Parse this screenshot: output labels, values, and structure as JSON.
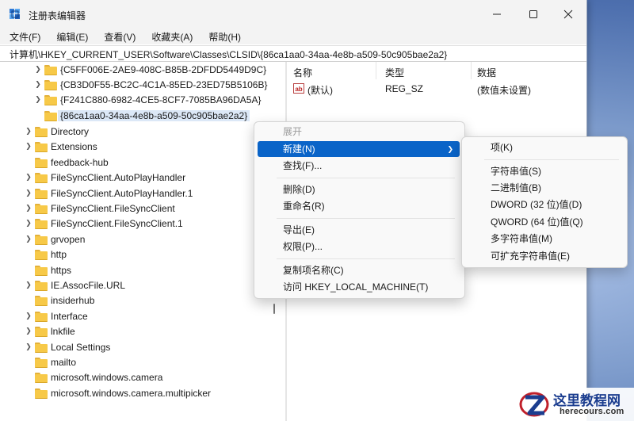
{
  "window": {
    "title": "注册表编辑器"
  },
  "menu": [
    "文件(F)",
    "编辑(E)",
    "查看(V)",
    "收藏夹(A)",
    "帮助(H)"
  ],
  "address": "计算机\\HKEY_CURRENT_USER\\Software\\Classes\\CLSID\\{86ca1aa0-34aa-4e8b-a509-50c905bae2a2}",
  "tree": {
    "subkeys": [
      "{C5FF006E-2AE9-408C-B85B-2DFDD5449D9C}",
      "{CB3D0F55-BC2C-4C1A-85ED-23ED75B5106B}",
      "{F241C880-6982-4CE5-8CF7-7085BA96DA5A}",
      "{86ca1aa0-34aa-4e8b-a509-50c905bae2a2}"
    ],
    "keys": [
      {
        "label": "Directory",
        "expand": true
      },
      {
        "label": "Extensions",
        "expand": true
      },
      {
        "label": "feedback-hub",
        "expand": false
      },
      {
        "label": "FileSyncClient.AutoPlayHandler",
        "expand": true
      },
      {
        "label": "FileSyncClient.AutoPlayHandler.1",
        "expand": true
      },
      {
        "label": "FileSyncClient.FileSyncClient",
        "expand": true
      },
      {
        "label": "FileSyncClient.FileSyncClient.1",
        "expand": true
      },
      {
        "label": "grvopen",
        "expand": true
      },
      {
        "label": "http",
        "expand": false
      },
      {
        "label": "https",
        "expand": false
      },
      {
        "label": "IE.AssocFile.URL",
        "expand": true
      },
      {
        "label": "insiderhub",
        "expand": false
      },
      {
        "label": "Interface",
        "expand": true
      },
      {
        "label": "lnkfile",
        "expand": true
      },
      {
        "label": "Local Settings",
        "expand": true
      },
      {
        "label": "mailto",
        "expand": false
      },
      {
        "label": "microsoft.windows.camera",
        "expand": false
      },
      {
        "label": "microsoft.windows.camera.multipicker",
        "expand": false
      }
    ]
  },
  "list": {
    "headers": [
      "名称",
      "类型",
      "数据"
    ],
    "rows": [
      {
        "name": "(默认)",
        "type": "REG_SZ",
        "data": "(数值未设置)",
        "icon": "ab-icon"
      }
    ]
  },
  "context_menu": {
    "expand": "展开",
    "new": "新建(N)",
    "find": "查找(F)...",
    "delete": "删除(D)",
    "rename": "重命名(R)",
    "export": "导出(E)",
    "permissions": "权限(P)...",
    "copy_key_name": "复制项名称(C)",
    "visit": "访问 HKEY_LOCAL_MACHINE(T)"
  },
  "submenu": {
    "key": "项(K)",
    "string": "字符串值(S)",
    "binary": "二进制值(B)",
    "dword": "DWORD (32 位)值(D)",
    "qword": "QWORD (64 位)值(Q)",
    "multi_string": "多字符串值(M)",
    "expandable_string": "可扩充字符串值(E)"
  },
  "watermark": {
    "title": "这里教程网",
    "url": "herecours.com"
  },
  "colors": {
    "highlight": "#0a64c8",
    "folder": "#f7c948",
    "selected_bg": "#dce8f7"
  }
}
